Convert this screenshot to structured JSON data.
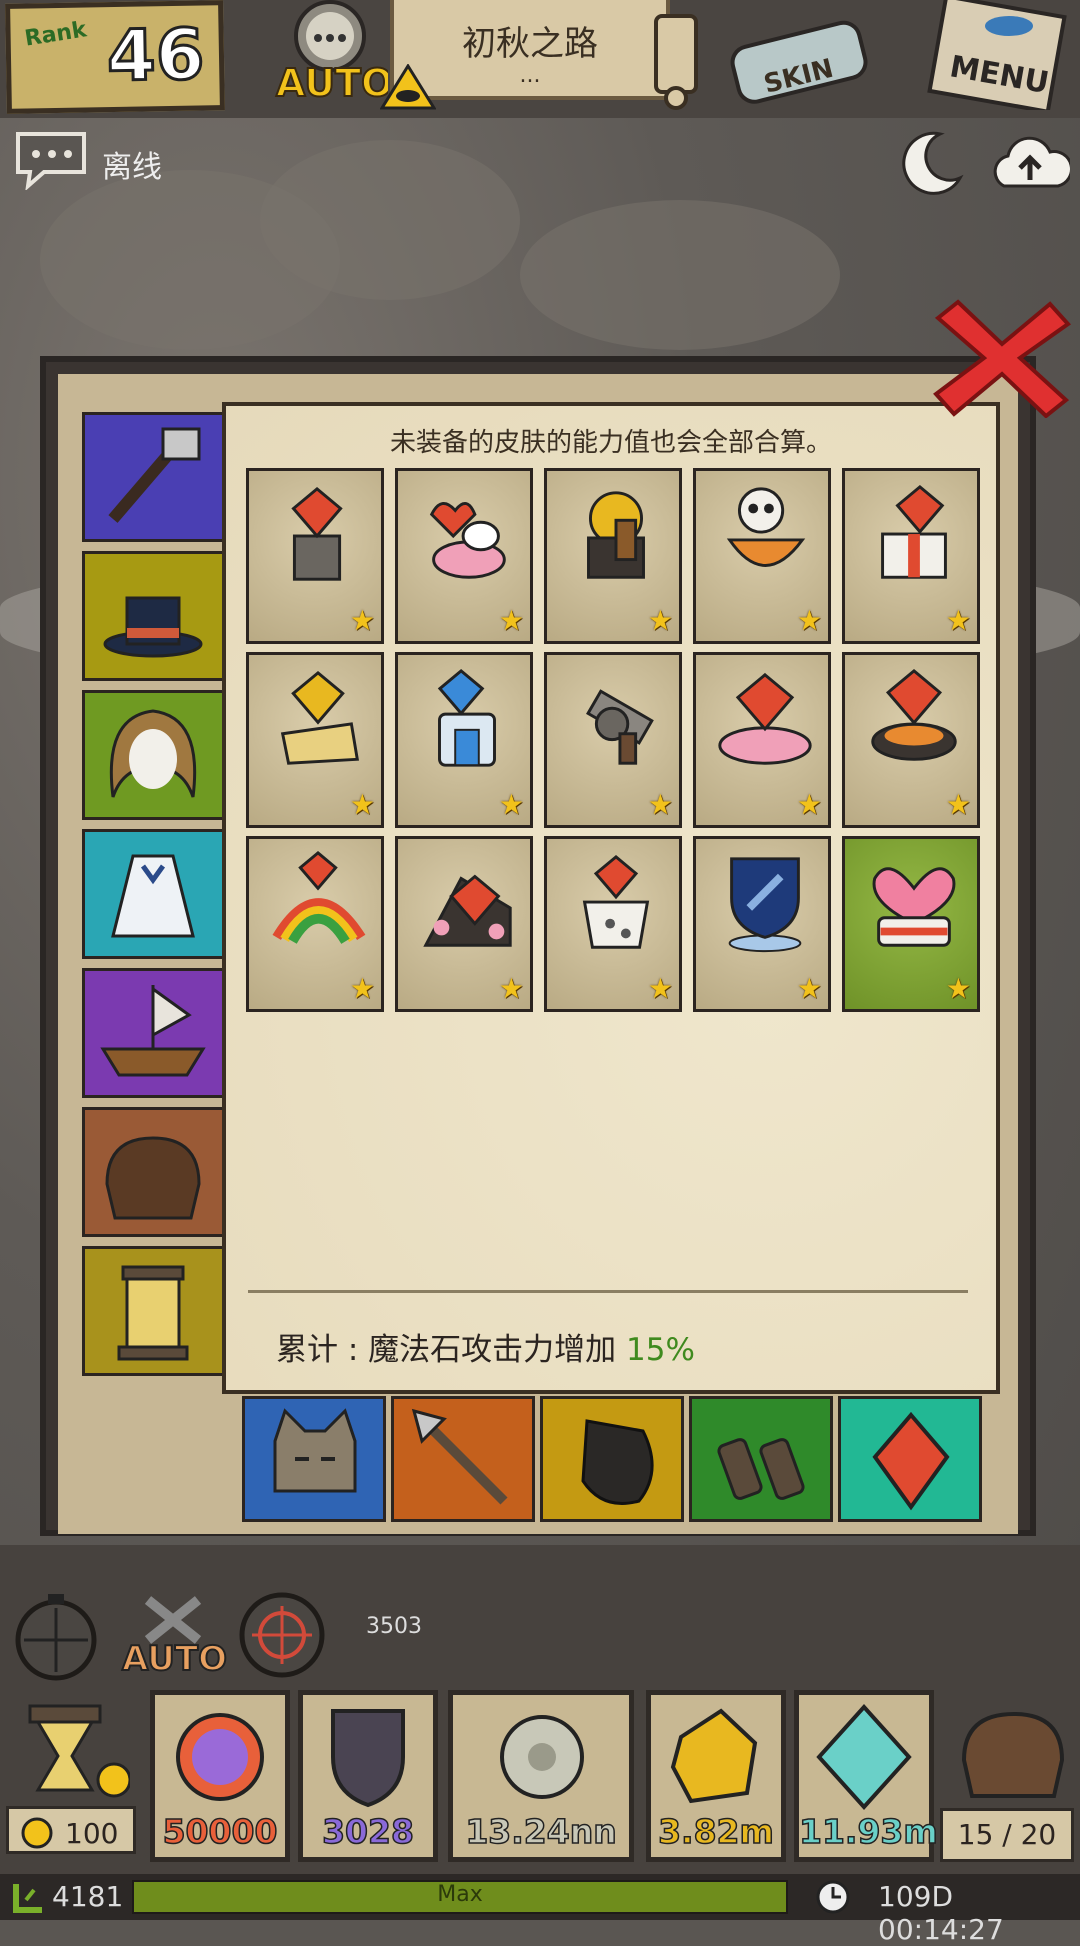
{
  "header": {
    "rank_label": "Rank",
    "rank_value": "46",
    "auto_label": "AUTO",
    "stage_title": "初秋之路",
    "stage_sub": "...",
    "skin_label": "SKIN",
    "menu_label": "MENU"
  },
  "status": {
    "chat_status": "离线"
  },
  "skins_panel": {
    "hint": "未装备的皮肤的能力值也会全部合算。",
    "total_label": "累计 : 魔法石攻击力增加 ",
    "total_value": "15%",
    "grid": [
      {
        "icon": "crystal-pedestal-icon",
        "stars": 1
      },
      {
        "icon": "bunny-heart-pot-icon",
        "stars": 1
      },
      {
        "icon": "gold-cannon-icon",
        "stars": 1
      },
      {
        "icon": "skull-cauldron-icon",
        "stars": 1
      },
      {
        "icon": "gift-crystal-icon",
        "stars": 1
      },
      {
        "icon": "gold-crystal-book-icon",
        "stars": 1
      },
      {
        "icon": "blue-crystal-shrine-icon",
        "stars": 1
      },
      {
        "icon": "revolver-icon",
        "stars": 1
      },
      {
        "icon": "crystal-pink-cloud-icon",
        "stars": 1
      },
      {
        "icon": "crystal-bowl-icon",
        "stars": 1
      },
      {
        "icon": "rainbow-crystal-icon",
        "stars": 1
      },
      {
        "icon": "sakura-crystal-icon",
        "stars": 1
      },
      {
        "icon": "cup-crystal-icon",
        "stars": 1
      },
      {
        "icon": "night-shield-icon",
        "stars": 1
      },
      {
        "icon": "heart-cake-icon",
        "stars": 1
      }
    ],
    "selected_index": 14,
    "left_tabs": [
      "wrench-tools-icon",
      "top-hat-icon",
      "hair-icon",
      "dress-icon",
      "boat-icon",
      "satchel-icon",
      "lantern-icon"
    ],
    "left_tab_colors": [
      "#4a3fb3",
      "#a79a12",
      "#6f9a22",
      "#2aa6b4",
      "#7b3ab0",
      "#9a5a36",
      "#a8921c"
    ],
    "bottom_tabs": [
      "cat-face-icon",
      "arrow-icon",
      "sack-icon",
      "binoculars-icon",
      "crystal-icon"
    ],
    "bottom_tab_colors": [
      "#2f64b4",
      "#c4601c",
      "#c49a12",
      "#2f8a2a",
      "#22b894"
    ]
  },
  "hud": {
    "distance": "3503",
    "auto_label": "AUTO",
    "energy": "100",
    "resources": [
      {
        "name": "magic-orb",
        "value": "50000",
        "color": "#e8603a"
      },
      {
        "name": "dark-shield",
        "value": "3028",
        "color": "#8a6ad8"
      },
      {
        "name": "silver-gear",
        "value": "13.24nn",
        "color": "#c8c8b8"
      },
      {
        "name": "gold-nugget",
        "value": "3.82m",
        "color": "#e8b820"
      },
      {
        "name": "diamond",
        "value": "11.93m",
        "color": "#6ad0c8"
      }
    ],
    "bag_count": "15 / 20",
    "level": "4181",
    "xp_label": "Max",
    "timer": "109D 00:14:27"
  }
}
